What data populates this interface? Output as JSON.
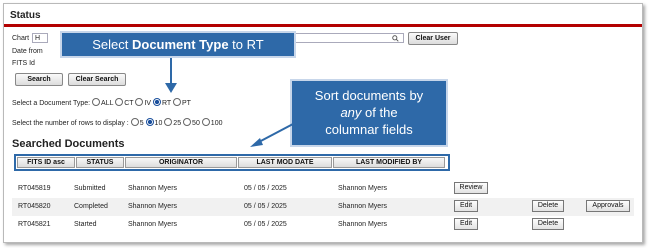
{
  "status_title": "Status",
  "search_form": {
    "chart_label": "Chart",
    "chart_value": "H",
    "date_from_label": "Date from",
    "fits_id_label": "FITS Id",
    "clear_user_label": "Clear User",
    "search_label": "Search",
    "clear_search_label": "Clear Search",
    "doc_type_label": "Select a Document Type:",
    "doc_types": [
      "ALL",
      "CT",
      "IV",
      "RT",
      "PT"
    ],
    "doc_type_selected": "RT",
    "rows_label": "Select the number of rows to display :",
    "row_options": [
      "5",
      "10",
      "25",
      "50",
      "100"
    ],
    "rows_selected": "10"
  },
  "callouts": {
    "doc_type": {
      "prefix": "Select ",
      "bold": "Document Type",
      "suffix": " to RT"
    },
    "sort": {
      "line1": "Sort documents by",
      "line2_italic": "any",
      "line2_rest": " of the",
      "line3": "columnar fields"
    }
  },
  "section_title": "Searched Documents",
  "table": {
    "columns": [
      "FITS ID asc",
      "STATUS",
      "ORIGINATOR",
      "LAST MOD DATE",
      "LAST MODIFIED BY"
    ],
    "rows": [
      {
        "fits_id": "RT045819",
        "status": "Submitted",
        "originator": "Shannon Myers",
        "last_mod_date": "05 / 05 / 2025",
        "last_modified_by": "Shannon Myers",
        "actions": [
          "Review"
        ]
      },
      {
        "fits_id": "RT045820",
        "status": "Completed",
        "originator": "Shannon Myers",
        "last_mod_date": "05 / 05 / 2025",
        "last_modified_by": "Shannon Myers",
        "actions": [
          "Edit",
          "Delete",
          "Approvals"
        ]
      },
      {
        "fits_id": "RT045821",
        "status": "Started",
        "originator": "Shannon Myers",
        "last_mod_date": "05 / 05 / 2025",
        "last_modified_by": "Shannon Myers",
        "actions": [
          "Edit",
          "Delete"
        ]
      }
    ]
  },
  "colors": {
    "accent": "#2e69a8",
    "rule": "#b30000"
  },
  "icons": {
    "search_field_icon": "magnifier-icon",
    "arrow": "down-arrow-icon"
  }
}
